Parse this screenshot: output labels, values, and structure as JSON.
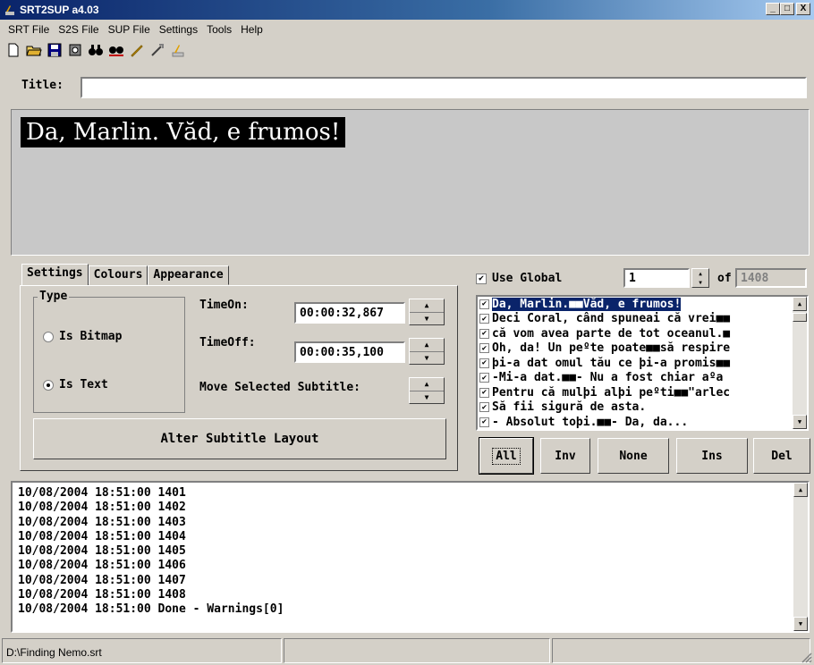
{
  "window": {
    "title": "SRT2SUP a4.03",
    "min_label": "_",
    "max_label": "□",
    "close_label": "X"
  },
  "menu": [
    "SRT File",
    "S2S File",
    "SUP File",
    "Settings",
    "Tools",
    "Help"
  ],
  "toolbar": [
    {
      "name": "new-file-icon"
    },
    {
      "name": "open-folder-icon"
    },
    {
      "name": "save-disk-icon"
    },
    {
      "name": "settings-icon"
    },
    {
      "name": "find-binoculars-icon"
    },
    {
      "name": "find-next-icon"
    },
    {
      "name": "pencil-icon"
    },
    {
      "name": "wand-icon"
    },
    {
      "name": "app-icon"
    }
  ],
  "title_field": {
    "label": "Title:",
    "value": ""
  },
  "preview": {
    "text": "Da, Marlin. Văd, e frumos!"
  },
  "tabs": [
    "Settings",
    "Colours",
    "Appearance"
  ],
  "settings": {
    "type_legend": "Type",
    "is_bitmap": "Is Bitmap",
    "is_text": "Is Text",
    "selected_type": "Is Text",
    "time_on_label": "TimeOn:",
    "time_on_value": "00:00:32,867",
    "time_off_label": "TimeOff:",
    "time_off_value": "00:00:35,100",
    "move_label": "Move Selected Subtitle:",
    "alter_button": "Alter Subtitle Layout"
  },
  "navigator": {
    "use_global_label": "Use Global",
    "use_global_checked": true,
    "current": "1",
    "of_label": "of",
    "total": "1408"
  },
  "subtitles": [
    {
      "text": "Da, Marlin.■■Văd, e frumos!",
      "checked": true,
      "selected": true
    },
    {
      "text": "Deci Coral, când spuneai că vrei■■",
      "checked": true,
      "selected": false
    },
    {
      "text": "că vom avea parte de tot oceanul.■",
      "checked": true,
      "selected": false
    },
    {
      "text": "Oh, da! Un peºte poate■■să respire",
      "checked": true,
      "selected": false
    },
    {
      "text": "þi-a dat omul tău ce þi-a promis■■",
      "checked": true,
      "selected": false
    },
    {
      "text": "-Mi-a dat.■■- Nu a fost chiar aºa",
      "checked": true,
      "selected": false
    },
    {
      "text": "Pentru că mulþi alþi peºti■■\"arlec",
      "checked": true,
      "selected": false
    },
    {
      "text": "Să fii sigură de asta.",
      "checked": true,
      "selected": false
    },
    {
      "text": "- Absolut toþi.■■- Da, da...",
      "checked": true,
      "selected": false
    }
  ],
  "list_buttons": [
    "All",
    "Inv",
    "None",
    "Ins",
    "Del"
  ],
  "log": [
    "10/08/2004 18:51:00 1401",
    "10/08/2004 18:51:00 1402",
    "10/08/2004 18:51:00 1403",
    "10/08/2004 18:51:00 1404",
    "10/08/2004 18:51:00 1405",
    "10/08/2004 18:51:00 1406",
    "10/08/2004 18:51:00 1407",
    "10/08/2004 18:51:00 1408",
    "10/08/2004 18:51:00 Done - Warnings[0]"
  ],
  "status": {
    "file_path": "D:\\Finding Nemo.srt",
    "panel2": "",
    "panel3": ""
  }
}
